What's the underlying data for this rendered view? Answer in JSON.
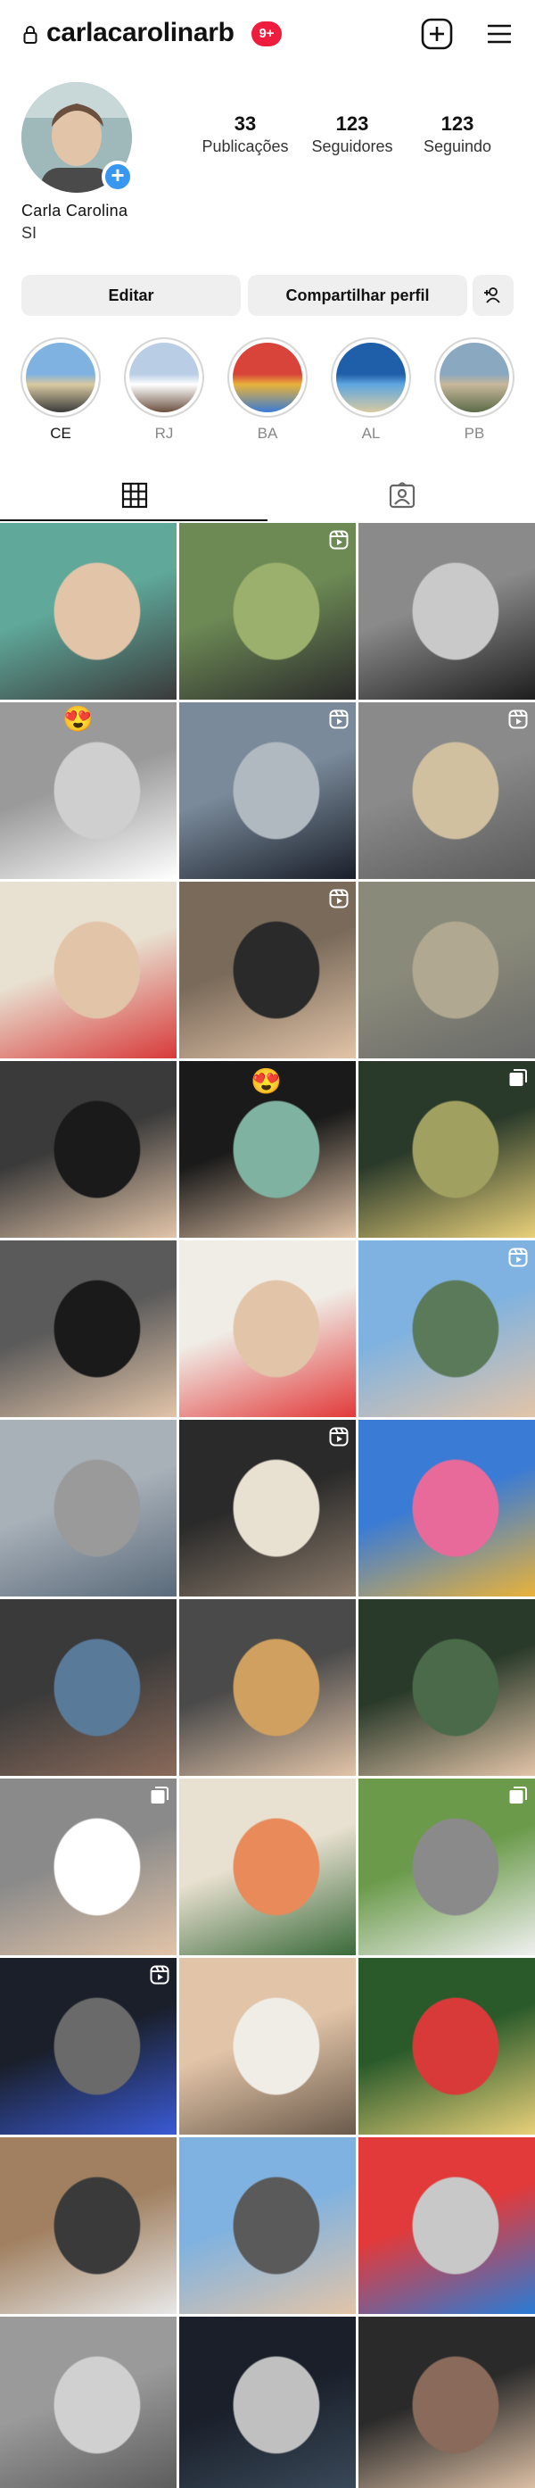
{
  "header": {
    "username": "carlacarolinarb",
    "notification_count": "9+",
    "lock_icon": "lock-icon",
    "create_icon": "plus-square-icon",
    "menu_icon": "hamburger-menu-icon"
  },
  "profile": {
    "display_name": "Carla Carolina",
    "bio": "SI",
    "stats": [
      {
        "value": "33",
        "label": "Publicações"
      },
      {
        "value": "123",
        "label": "Seguidores"
      },
      {
        "value": "123",
        "label": "Seguindo"
      }
    ]
  },
  "actions": {
    "edit_label": "Editar",
    "share_label": "Compartilhar perfil",
    "add_person_icon": "add-person-icon"
  },
  "highlights": [
    {
      "label": "CE",
      "colors": [
        "#7fb2e0",
        "#d8c9a0",
        "#3a3a3a"
      ]
    },
    {
      "label": "RJ",
      "colors": [
        "#b9cde4",
        "#ffffff",
        "#6b4f3f"
      ]
    },
    {
      "label": "BA",
      "colors": [
        "#d8433a",
        "#e8b23b",
        "#3a7bd5"
      ]
    },
    {
      "label": "AL",
      "colors": [
        "#1f5ea8",
        "#5fa6e0",
        "#d8c9a0"
      ]
    },
    {
      "label": "PB",
      "colors": [
        "#8aa8c0",
        "#c7b79a",
        "#5b6b4a"
      ]
    }
  ],
  "tabs": {
    "grid_icon": "grid-icon",
    "tagged_icon": "tagged-person-icon"
  },
  "posts": [
    {
      "type": "photo",
      "colors": [
        "#5fa89a",
        "#3a3a3a",
        "#e2c4a8"
      ]
    },
    {
      "type": "reel",
      "colors": [
        "#6d8a55",
        "#2b2b2b",
        "#9bb06c"
      ]
    },
    {
      "type": "photo",
      "colors": [
        "#8a8a8a",
        "#1e1e1e",
        "#c9c9c9"
      ]
    },
    {
      "type": "photo",
      "colors": [
        "#9a9a9a",
        "#ffffff",
        "#cfcfcf"
      ],
      "sticker": "😍"
    },
    {
      "type": "reel",
      "colors": [
        "#7a8a9a",
        "#1a1f2a",
        "#b0b8c0"
      ]
    },
    {
      "type": "reel",
      "colors": [
        "#8a8a8a",
        "#5a5a5a",
        "#d0c0a0"
      ]
    },
    {
      "type": "photo",
      "colors": [
        "#e8e0d0",
        "#d83a3a",
        "#e2c4a8"
      ]
    },
    {
      "type": "reel",
      "colors": [
        "#7a6a5a",
        "#e2c4a8",
        "#2a2a2a"
      ]
    },
    {
      "type": "photo",
      "colors": [
        "#8a8a7a",
        "#6a6a6a",
        "#b0a890"
      ]
    },
    {
      "type": "photo",
      "colors": [
        "#3a3a3a",
        "#e2c4a8",
        "#1a1a1a"
      ]
    },
    {
      "type": "photo",
      "colors": [
        "#1a1a1a",
        "#e2c4a8",
        "#7fb2a0"
      ],
      "sticker": "😍"
    },
    {
      "type": "carousel",
      "colors": [
        "#2a3a2a",
        "#e8d07a",
        "#a0a060"
      ]
    },
    {
      "type": "photo",
      "colors": [
        "#5a5a5a",
        "#e2c4a8",
        "#1a1a1a"
      ]
    },
    {
      "type": "photo",
      "colors": [
        "#f0ece6",
        "#e23a3a",
        "#e2c4a8"
      ]
    },
    {
      "type": "reel",
      "colors": [
        "#7fb2e0",
        "#e2c4a8",
        "#5a7a5a"
      ]
    },
    {
      "type": "photo",
      "colors": [
        "#a8b0b8",
        "#5a6a7a",
        "#9a9a9a"
      ]
    },
    {
      "type": "reel",
      "colors": [
        "#2a2a2a",
        "#8a7a6a",
        "#e8e0d0"
      ]
    },
    {
      "type": "photo",
      "colors": [
        "#3a7bd5",
        "#e8b23b",
        "#e86a9a"
      ]
    },
    {
      "type": "photo",
      "colors": [
        "#3a3a3a",
        "#8a6a5a",
        "#5a7a9a"
      ]
    },
    {
      "type": "photo",
      "colors": [
        "#4a4a4a",
        "#e2c4a8",
        "#d0a060"
      ]
    },
    {
      "type": "photo",
      "colors": [
        "#2a3a2a",
        "#e2c4a8",
        "#4a6a4a"
      ]
    },
    {
      "type": "carousel",
      "colors": [
        "#8a8a8a",
        "#e2c4a8",
        "#ffffff"
      ]
    },
    {
      "type": "photo",
      "colors": [
        "#e8e0d0",
        "#3a6a3a",
        "#e88a5a"
      ]
    },
    {
      "type": "carousel",
      "colors": [
        "#6a9a4a",
        "#f0f0f0",
        "#8a8a8a"
      ]
    },
    {
      "type": "reel",
      "colors": [
        "#1a1f2a",
        "#3a5ad5",
        "#6a6a6a"
      ]
    },
    {
      "type": "photo",
      "colors": [
        "#e2c4a8",
        "#6a5a4a",
        "#f0ece6"
      ]
    },
    {
      "type": "photo",
      "colors": [
        "#2a5a2a",
        "#e8d07a",
        "#d83a3a"
      ]
    },
    {
      "type": "photo",
      "colors": [
        "#a08060",
        "#e8e8e8",
        "#3a3a3a"
      ]
    },
    {
      "type": "photo",
      "colors": [
        "#7fb2e0",
        "#e2c4a8",
        "#5a5a5a"
      ]
    },
    {
      "type": "photo",
      "colors": [
        "#e23a3a",
        "#2a7bd5",
        "#c8c8c8"
      ]
    },
    {
      "type": "photo",
      "colors": [
        "#9a9a9a",
        "#5a5a5a",
        "#d0d0d0"
      ]
    },
    {
      "type": "photo",
      "colors": [
        "#1a1f2a",
        "#3a4a5a",
        "#c0c0c0"
      ]
    },
    {
      "type": "photo",
      "colors": [
        "#2a2a2a",
        "#e2c4a8",
        "#8a6a5a"
      ]
    }
  ]
}
